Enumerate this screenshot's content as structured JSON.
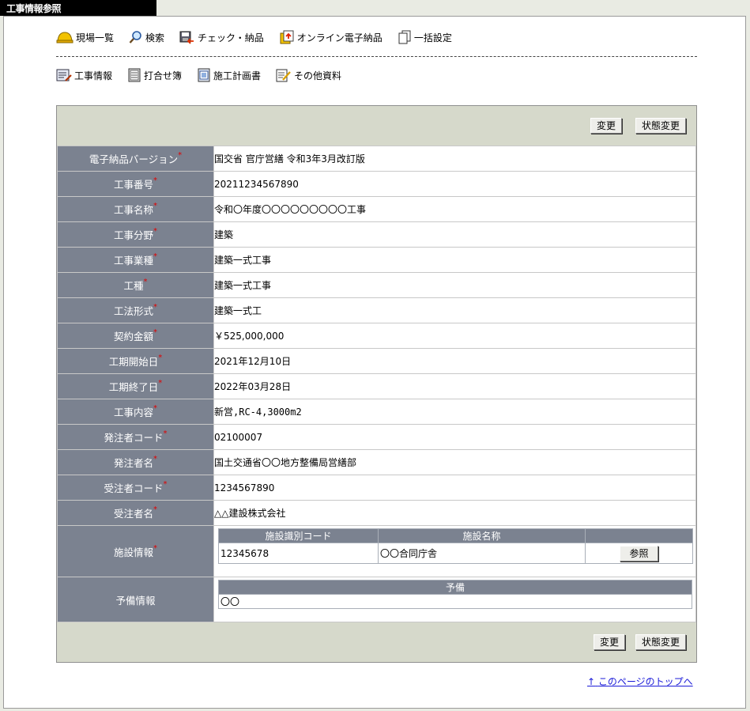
{
  "title": "工事情報参照",
  "toolbar": {
    "items": [
      {
        "icon": "hardhat-icon",
        "label": "現場一覧"
      },
      {
        "icon": "search-icon",
        "label": "検索"
      },
      {
        "icon": "check-delivery-icon",
        "label": "チェック・納品"
      },
      {
        "icon": "online-delivery-icon",
        "label": "オンライン電子納品"
      },
      {
        "icon": "bulk-settings-icon",
        "label": "一括設定"
      }
    ]
  },
  "subnav": {
    "items": [
      {
        "icon": "project-info-icon",
        "label": "工事情報"
      },
      {
        "icon": "meeting-book-icon",
        "label": "打合せ簿"
      },
      {
        "icon": "construction-plan-icon",
        "label": "施工計画書"
      },
      {
        "icon": "other-docs-icon",
        "label": "その他資料"
      }
    ]
  },
  "buttons": {
    "change": "変更",
    "status_change": "状態変更",
    "reference": "参照"
  },
  "fields": [
    {
      "label": "電子納品バージョン",
      "value": "国交省 官庁営繕 令和3年3月改訂版"
    },
    {
      "label": "工事番号",
      "value": "20211234567890"
    },
    {
      "label": "工事名称",
      "value": "令和〇年度〇〇〇〇〇〇〇〇〇工事"
    },
    {
      "label": "工事分野",
      "value": "建築"
    },
    {
      "label": "工事業種",
      "value": "建築一式工事"
    },
    {
      "label": "工種",
      "value": "建築一式工事"
    },
    {
      "label": "工法形式",
      "value": "建築一式工"
    },
    {
      "label": "契約金額",
      "value": "￥525,000,000"
    },
    {
      "label": "工期開始日",
      "value": "2021年12月10日"
    },
    {
      "label": "工期終了日",
      "value": "2022年03月28日"
    },
    {
      "label": "工事内容",
      "value": "新営,RC-4,3000m2"
    },
    {
      "label": "発注者コード",
      "value": "02100007"
    },
    {
      "label": "発注者名",
      "value": "国土交通省〇〇地方整備局営繕部"
    },
    {
      "label": "受注者コード",
      "value": "1234567890"
    },
    {
      "label": "受注者名",
      "value": "△△建設株式会社"
    }
  ],
  "facility": {
    "label": "施設情報",
    "headers": [
      "施設識別コード",
      "施設名称",
      ""
    ],
    "rows": [
      {
        "code": "12345678",
        "name": "〇〇合同庁舎"
      }
    ]
  },
  "reserve": {
    "label": "予備情報",
    "header": "予備",
    "value": "〇〇"
  },
  "required_mark": "*",
  "page_top_link": "このページのトップへ",
  "page_top_arrow": "↑"
}
